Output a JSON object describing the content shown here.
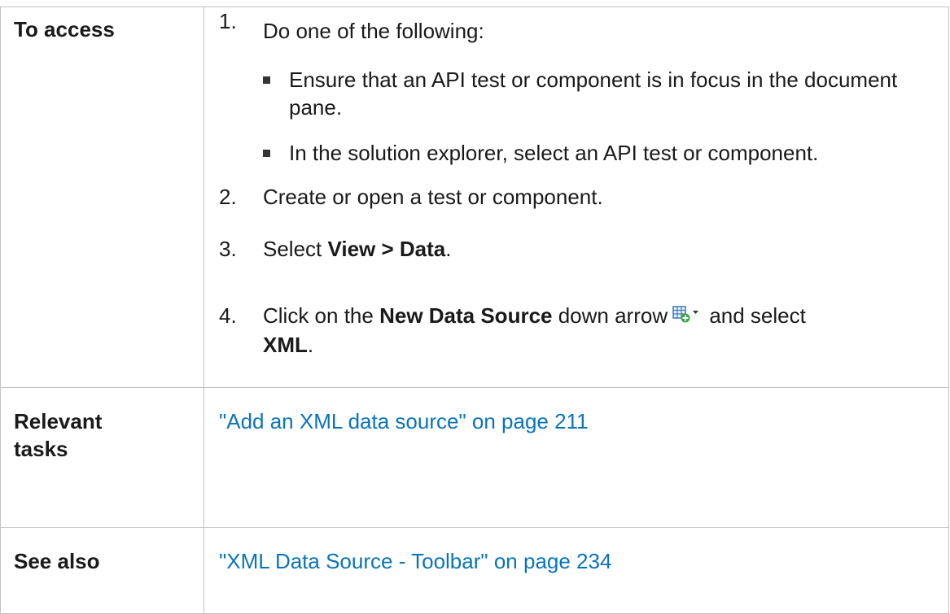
{
  "access": {
    "label": "To access",
    "steps": [
      {
        "num": "1.",
        "text": "Do one of the following:",
        "bullets": [
          "Ensure that an API test or component is in focus in the document pane.",
          "In the solution explorer, select an API test or component."
        ]
      },
      {
        "num": "2.",
        "text": "Create or open a test or component."
      },
      {
        "num": "3.",
        "prefix": "Select ",
        "bold": "View > Data",
        "suffix": "."
      },
      {
        "num": "4.",
        "prefix": "Click on the ",
        "bold": "New Data Source",
        "middle": " down arrow",
        "icon": "new-data-source-icon",
        "after_icon": " and select ",
        "bold2": "XML",
        "suffix": "."
      }
    ]
  },
  "tasks": {
    "label": "Relevant tasks",
    "link": "\"Add an XML data source\" on page 211"
  },
  "see_also": {
    "label": "See also",
    "link": "\"XML Data Source - Toolbar\" on page 234"
  },
  "colors": {
    "link": "#0a74b8",
    "border": "#c3c3c3",
    "icon_grid": "#3a7ab8",
    "icon_plus": "#3aa640"
  }
}
